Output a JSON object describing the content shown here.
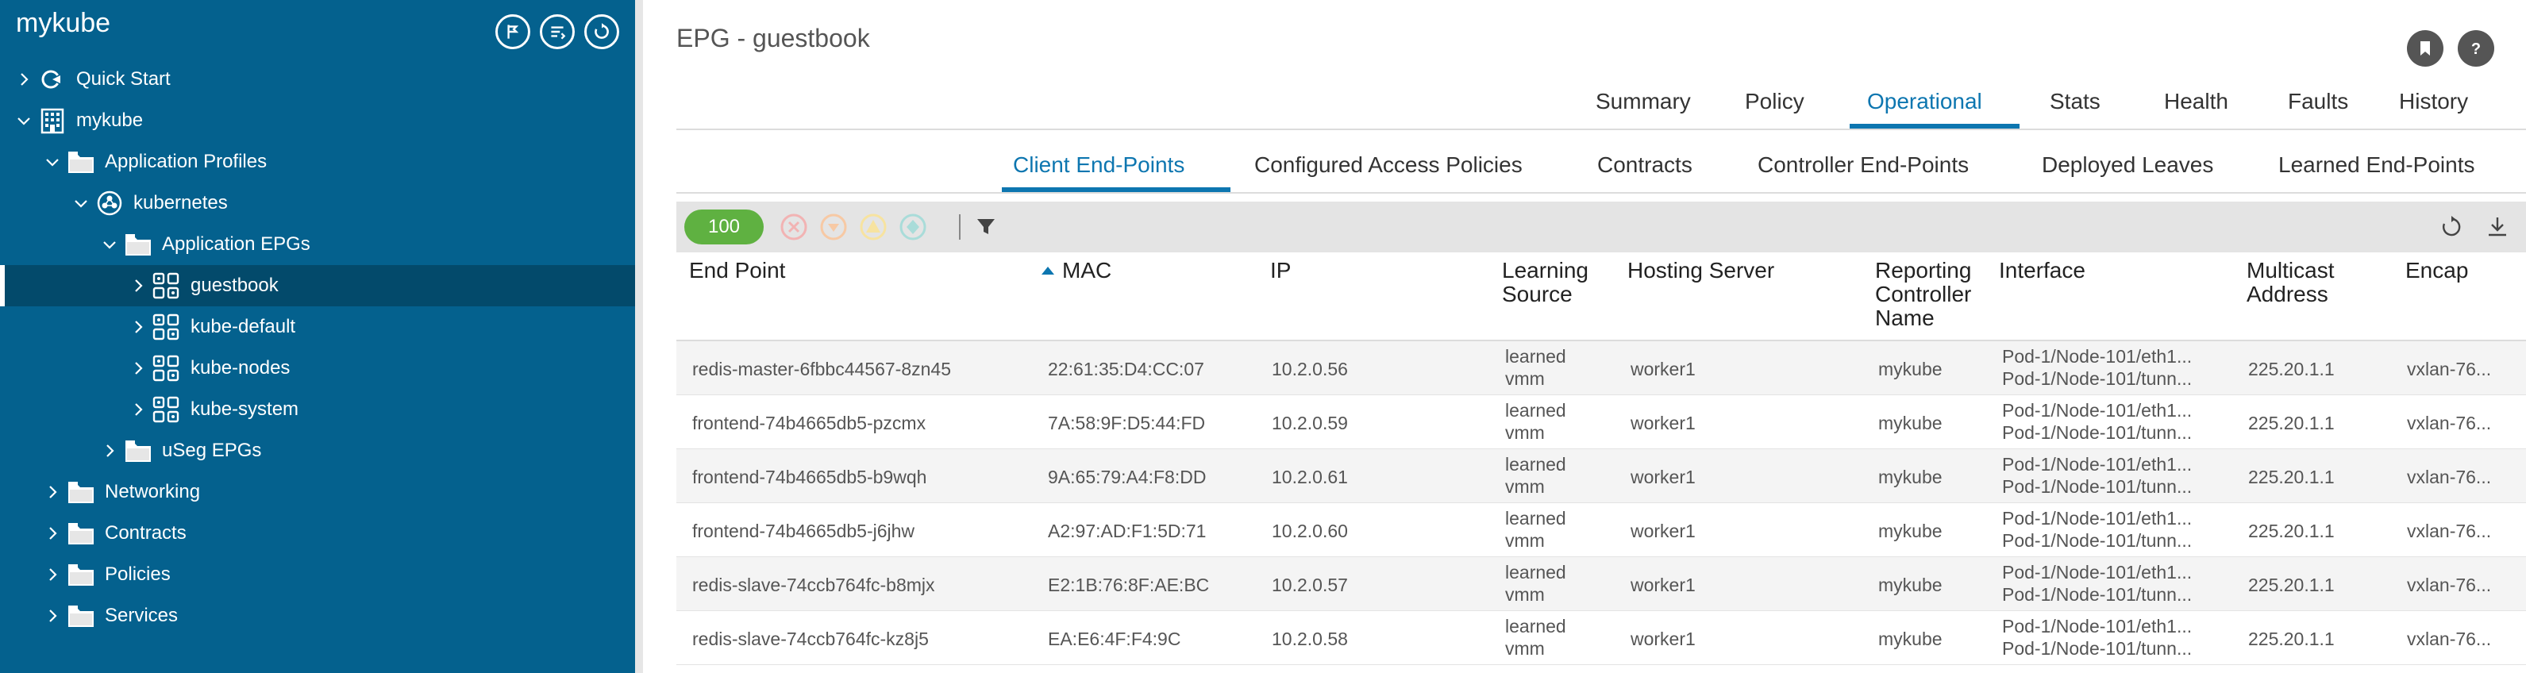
{
  "app": {
    "title": "mykube"
  },
  "sidebar": {
    "tree": [
      {
        "label": "Quick Start",
        "icon": "quick-start-icon",
        "expanded": false
      },
      {
        "label": "mykube",
        "icon": "tenant-building-icon",
        "expanded": true
      },
      {
        "label": "Application Profiles",
        "icon": "folder-icon",
        "expanded": true
      },
      {
        "label": "kubernetes",
        "icon": "application-profile-icon",
        "expanded": true
      },
      {
        "label": "Application EPGs",
        "icon": "folder-icon",
        "expanded": true
      },
      {
        "label": "guestbook",
        "icon": "epg-icon",
        "expanded": false,
        "selected": true
      },
      {
        "label": "kube-default",
        "icon": "epg-icon",
        "expanded": false
      },
      {
        "label": "kube-nodes",
        "icon": "epg-icon",
        "expanded": false
      },
      {
        "label": "kube-system",
        "icon": "epg-icon",
        "expanded": false
      },
      {
        "label": "uSeg EPGs",
        "icon": "folder-icon",
        "expanded": false
      },
      {
        "label": "Networking",
        "icon": "folder-icon",
        "expanded": false
      },
      {
        "label": "Contracts",
        "icon": "folder-icon",
        "expanded": false
      },
      {
        "label": "Policies",
        "icon": "folder-icon",
        "expanded": false
      },
      {
        "label": "Services",
        "icon": "folder-icon",
        "expanded": false
      }
    ]
  },
  "main": {
    "title": "EPG - guestbook",
    "tabs": [
      "Summary",
      "Policy",
      "Operational",
      "Stats",
      "Health",
      "Faults",
      "History"
    ],
    "active_tab": "Operational",
    "subtabs": [
      "Client End-Points",
      "Configured Access Policies",
      "Contracts",
      "Controller End-Points",
      "Deployed Leaves",
      "Learned End-Points"
    ],
    "active_subtab": "Client End-Points",
    "toolbar": {
      "count": "100"
    },
    "columns": {
      "endpoint": "End Point",
      "mac": "MAC",
      "ip": "IP",
      "learning_source_1": "Learning",
      "learning_source_2": "Source",
      "hosting_server": "Hosting Server",
      "reporting_1": "Reporting",
      "reporting_2": "Controller",
      "reporting_3": "Name",
      "interface": "Interface",
      "multicast_1": "Multicast",
      "multicast_2": "Address",
      "encap": "Encap"
    },
    "rows": [
      {
        "endpoint": "redis-master-6fbbc44567-8zn45",
        "mac": "22:61:35:D4:CC:07",
        "ip": "10.2.0.56",
        "ls1": "learned",
        "ls2": "vmm",
        "server": "worker1",
        "controller": "mykube",
        "if1": "Pod-1/Node-101/eth1...",
        "if2": "Pod-1/Node-101/tunn...",
        "multicast": "225.20.1.1",
        "encap": "vxlan-76..."
      },
      {
        "endpoint": "frontend-74b4665db5-pzcmx",
        "mac": "7A:58:9F:D5:44:FD",
        "ip": "10.2.0.59",
        "ls1": "learned",
        "ls2": "vmm",
        "server": "worker1",
        "controller": "mykube",
        "if1": "Pod-1/Node-101/eth1...",
        "if2": "Pod-1/Node-101/tunn...",
        "multicast": "225.20.1.1",
        "encap": "vxlan-76..."
      },
      {
        "endpoint": "frontend-74b4665db5-b9wqh",
        "mac": "9A:65:79:A4:F8:DD",
        "ip": "10.2.0.61",
        "ls1": "learned",
        "ls2": "vmm",
        "server": "worker1",
        "controller": "mykube",
        "if1": "Pod-1/Node-101/eth1...",
        "if2": "Pod-1/Node-101/tunn...",
        "multicast": "225.20.1.1",
        "encap": "vxlan-76..."
      },
      {
        "endpoint": "frontend-74b4665db5-j6jhw",
        "mac": "A2:97:AD:F1:5D:71",
        "ip": "10.2.0.60",
        "ls1": "learned",
        "ls2": "vmm",
        "server": "worker1",
        "controller": "mykube",
        "if1": "Pod-1/Node-101/eth1...",
        "if2": "Pod-1/Node-101/tunn...",
        "multicast": "225.20.1.1",
        "encap": "vxlan-76..."
      },
      {
        "endpoint": "redis-slave-74ccb764fc-b8mjx",
        "mac": "E2:1B:76:8F:AE:BC",
        "ip": "10.2.0.57",
        "ls1": "learned",
        "ls2": "vmm",
        "server": "worker1",
        "controller": "mykube",
        "if1": "Pod-1/Node-101/eth1...",
        "if2": "Pod-1/Node-101/tunn...",
        "multicast": "225.20.1.1",
        "encap": "vxlan-76..."
      },
      {
        "endpoint": "redis-slave-74ccb764fc-kz8j5",
        "mac": "EA:E6:4F:F4:9C",
        "ip": "10.2.0.58",
        "ls1": "learned",
        "ls2": "vmm",
        "server": "worker1",
        "controller": "mykube",
        "if1": "Pod-1/Node-101/eth1...",
        "if2": "Pod-1/Node-101/tunn...",
        "multicast": "225.20.1.1",
        "encap": "vxlan-76..."
      }
    ]
  },
  "colors": {
    "sidebar_bg": "#04618e",
    "accent": "#0d76b0",
    "count_pill": "#5fb141"
  }
}
